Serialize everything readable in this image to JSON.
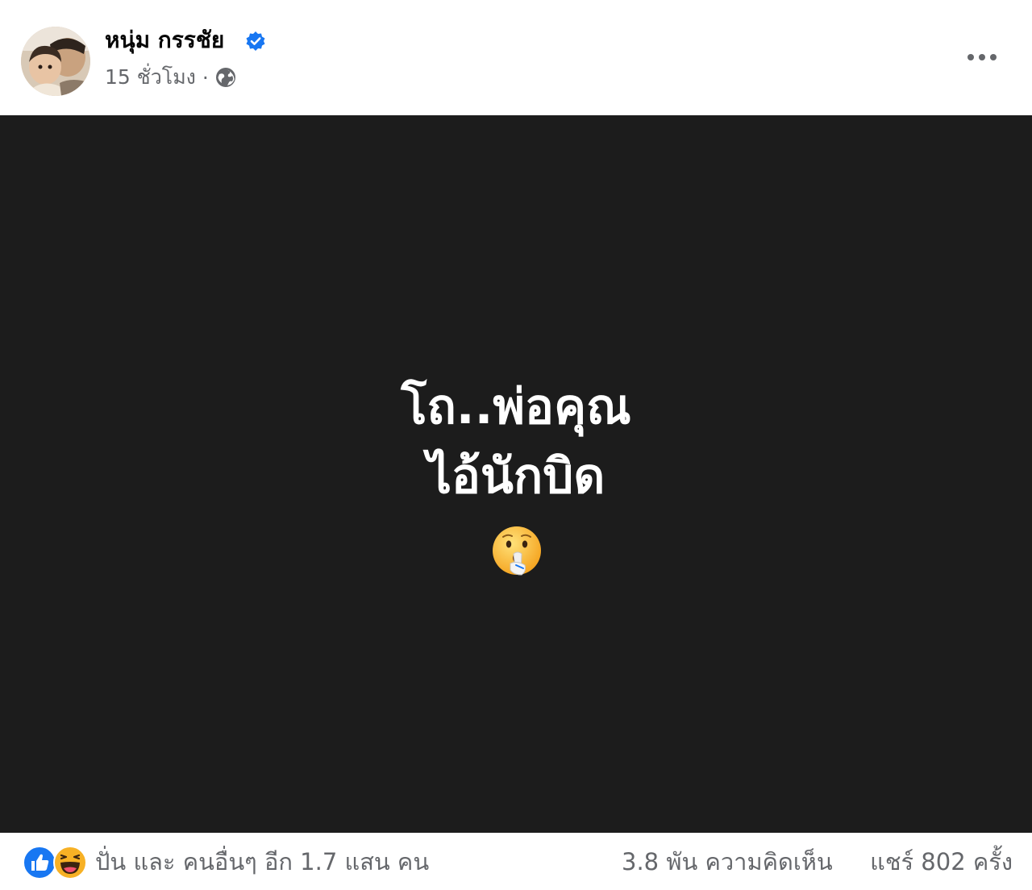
{
  "post": {
    "author": "หนุ่ม กรรชัย",
    "timestamp": "15 ชั่วโมง",
    "separator": "·",
    "icons": {
      "verified": "verified-badge-icon",
      "audience": "globe-icon",
      "more": "more-options-icon"
    }
  },
  "image": {
    "line1": "โถ..พ่อคุณ",
    "line2": "ไอ้นักบิด",
    "emoji": "shushing-face-icon",
    "background": "#1c1c1c"
  },
  "footer": {
    "reaction_icons": [
      "like-icon",
      "haha-icon"
    ],
    "reactions": "ปั่น และ คนอื่นๆ อีก 1.7 แสน คน",
    "comments": "3.8 พัน ความคิดเห็น",
    "shares": "แชร์ 802 ครั้ง"
  },
  "colors": {
    "verified": "#1877f2",
    "like": "#1877f2",
    "haha": "#f7b125",
    "secondary_text": "#65676b"
  }
}
